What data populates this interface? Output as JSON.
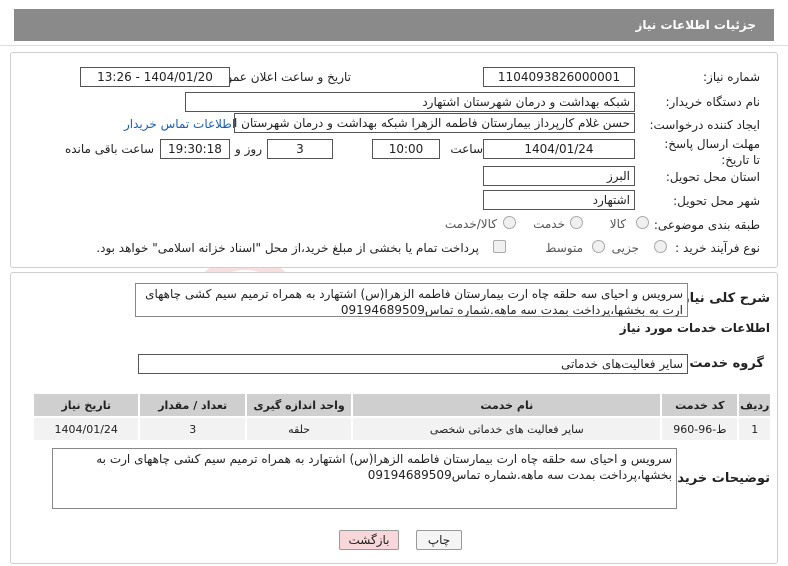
{
  "header": {
    "title": "جزئیات اطلاعات نیاز"
  },
  "form": {
    "need_number_label": "شماره نیاز:",
    "need_number": "1104093826000001",
    "announce_label": "تاریخ و ساعت اعلان عمومی:",
    "announce_value": "1404/01/20 - 13:26",
    "buyer_org_label": "نام دستگاه خریدار:",
    "buyer_org": "شبکه بهداشت و درمان شهرستان اشتهارد",
    "creator_label": "ایجاد کننده درخواست:",
    "creator": "حسن غلام کارپرداز بیمارستان فاطمه الزهرا شبکه بهداشت و درمان شهرستان ا",
    "buyer_contact_link": "اطلاعات تماس خریدار",
    "deadline_label": "مهلت ارسال پاسخ: تا تاریخ:",
    "deadline_date": "1404/01/24",
    "time_label": "ساعت",
    "deadline_time": "10:00",
    "days_value": "3",
    "days_label": "روز و",
    "remaining_time": "19:30:18",
    "remaining_label": "ساعت باقی مانده",
    "province_label": "استان محل تحویل:",
    "province": "البرز",
    "city_label": "شهر محل تحویل:",
    "city": "اشتهارد",
    "category_label": "طبقه بندی موضوعی:",
    "category_options": [
      "کالا",
      "خدمت",
      "کالا/خدمت"
    ],
    "process_label": "نوع فرآیند خرید :",
    "process_options": [
      "جزیی",
      "متوسط"
    ],
    "payment_note": "پرداخت تمام یا بخشی از مبلغ خرید،از محل \"اسناد خزانه اسلامی\" خواهد بود."
  },
  "summary": {
    "label": "شرح کلی نیاز:",
    "text": "سرویس و احیای سه حلقه چاه ارت بیمارستان فاطمه الزهرا(س) اشتهارد به همراه ترمیم سیم کشی چاههای ارت به بخشها،پرداخت بمدت سه ماهه.شماره تماس09194689509"
  },
  "services": {
    "section_title": "اطلاعات خدمات مورد نیاز",
    "group_label": "گروه خدمت:",
    "group_value": "سایر فعالیت‌های خدماتی",
    "columns": [
      "ردیف",
      "کد خدمت",
      "نام خدمت",
      "واحد اندازه گیری",
      "تعداد / مقدار",
      "تاریخ نیاز"
    ],
    "rows": [
      [
        "1",
        "ط-96-960",
        "سایر فعالیت های خدماتی شخصی",
        "حلقه",
        "3",
        "1404/01/24"
      ]
    ]
  },
  "buyer_notes": {
    "label": "توضیحات خریدار:",
    "text": "سرویس و احیای سه حلقه چاه ارت بیمارستان فاطمه الزهرا(س) اشتهارد به همراه ترمیم سیم کشی چاههای ارت به بخشها،پرداخت بمدت سه ماهه.شماره تماس09194689509"
  },
  "buttons": {
    "print": "چاپ",
    "back": "بازگشت"
  },
  "colors": {
    "header_bg": "#8a8a8a",
    "link": "#1a5fb4",
    "back_button_bg": "#f8d7da"
  }
}
